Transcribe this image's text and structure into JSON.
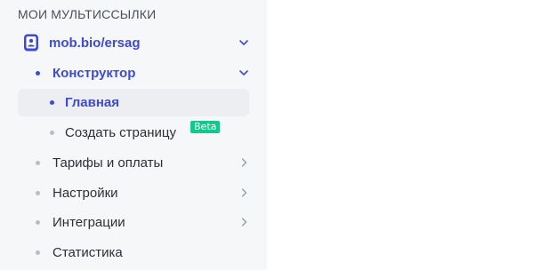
{
  "sidebar": {
    "section_title": "Мои мультиссылки",
    "site": {
      "label": "mob.bio/ersag",
      "icon": "profile-card-icon",
      "expanded": true
    },
    "items": [
      {
        "label": "Конструктор",
        "active": true,
        "expanded": true,
        "children": [
          {
            "label": "Главная",
            "active": true
          },
          {
            "label": "Создать страницу",
            "badge": "Beta"
          }
        ]
      },
      {
        "label": "Тарифы и оплаты",
        "has_chevron": true
      },
      {
        "label": "Настройки",
        "has_chevron": true
      },
      {
        "label": "Интеграции",
        "has_chevron": true
      },
      {
        "label": "Статистика",
        "has_chevron": false
      }
    ]
  },
  "colors": {
    "accent": "#3f4ad3",
    "badge": "#14c78a",
    "sidebar_bg": "#f6f7f8",
    "active_bg": "#eceef2"
  }
}
